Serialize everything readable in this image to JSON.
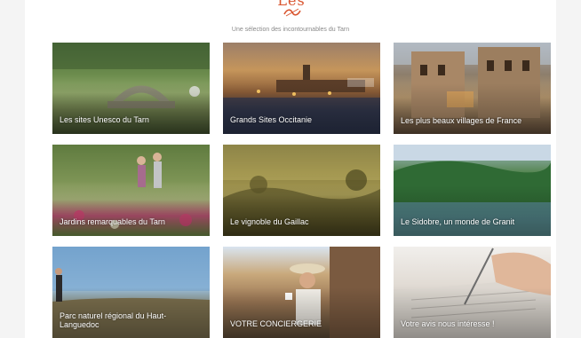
{
  "header": {
    "title_fragment": "Les incontournables",
    "subtitle": "Une sélection des incontournables du Tarn"
  },
  "tiles": [
    {
      "label": "Les sites Unesco du Tarn"
    },
    {
      "label": "Grands Sites Occitanie"
    },
    {
      "label": "Les plus beaux villages de France"
    },
    {
      "label": "Jardins remarquables du Tarn"
    },
    {
      "label": "Le vignoble du Gaillac"
    },
    {
      "label": "Le Sidobre, un monde de Granit"
    },
    {
      "label": "Parc naturel régional du Haut-Languedoc"
    },
    {
      "label": "VOTRE CONCIERGERIE"
    },
    {
      "label": "Votre avis nous intéresse !"
    }
  ],
  "colors": {
    "accent": "#d9552f",
    "subtitle": "#8a8a8a",
    "background": "#f4f4f4"
  }
}
